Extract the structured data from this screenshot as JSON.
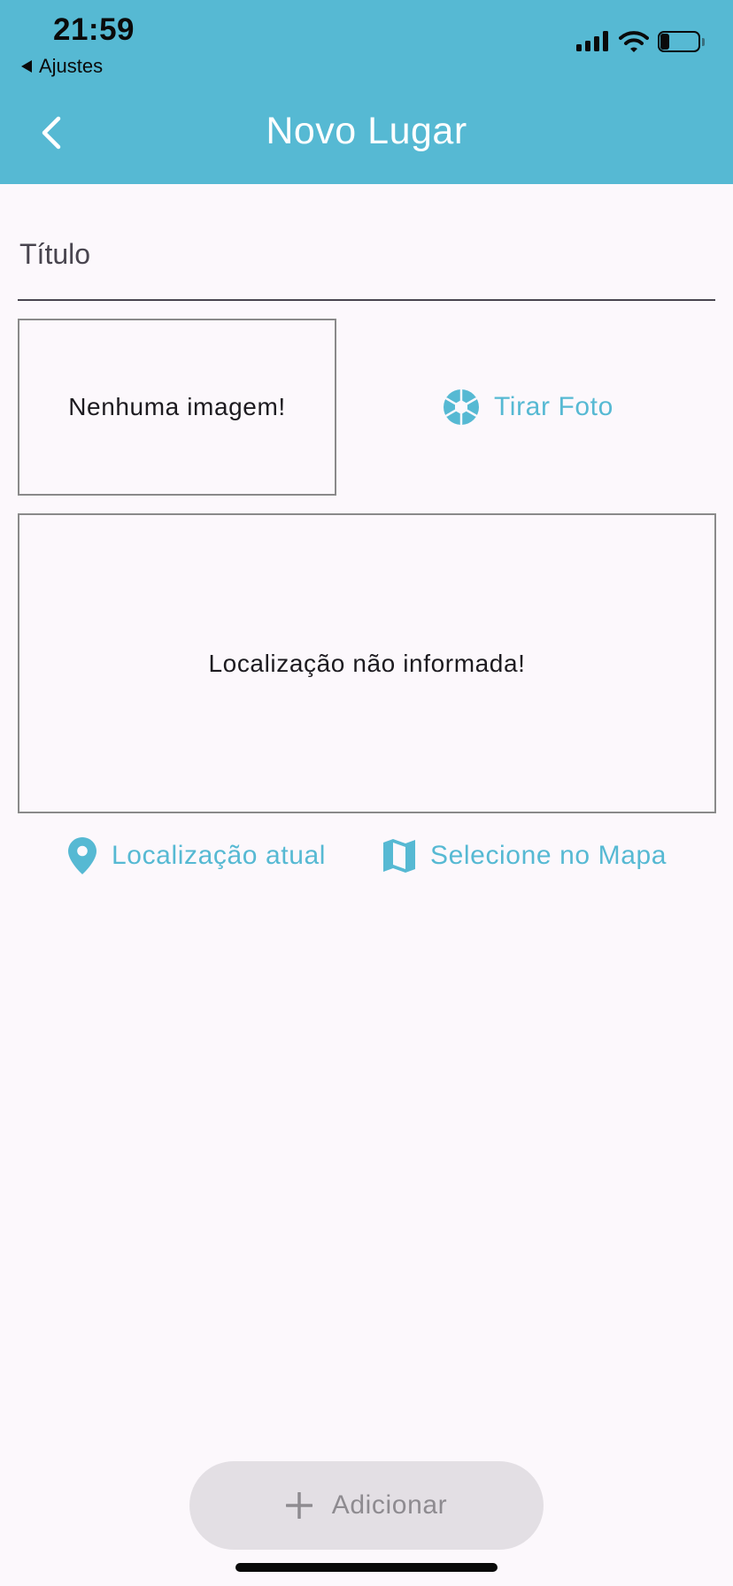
{
  "status_bar": {
    "time": "21:59",
    "back_to_app": "Ajustes",
    "battery_level": "24"
  },
  "header": {
    "title": "Novo Lugar"
  },
  "form": {
    "title_placeholder": "Título",
    "title_value": ""
  },
  "image_input": {
    "empty_text": "Nenhuma imagem!",
    "take_photo_label": "Tirar Foto"
  },
  "location_input": {
    "empty_text": "Localização não informada!",
    "current_location_label": "Localização atual",
    "select_on_map_label": "Selecione no Mapa"
  },
  "footer": {
    "add_button_label": "Adicionar"
  },
  "colors": {
    "primary": "#56b9d3",
    "background": "#fcf8fc",
    "disabled_button_bg": "#e3dfe4",
    "disabled_button_text": "#8e8b90"
  }
}
